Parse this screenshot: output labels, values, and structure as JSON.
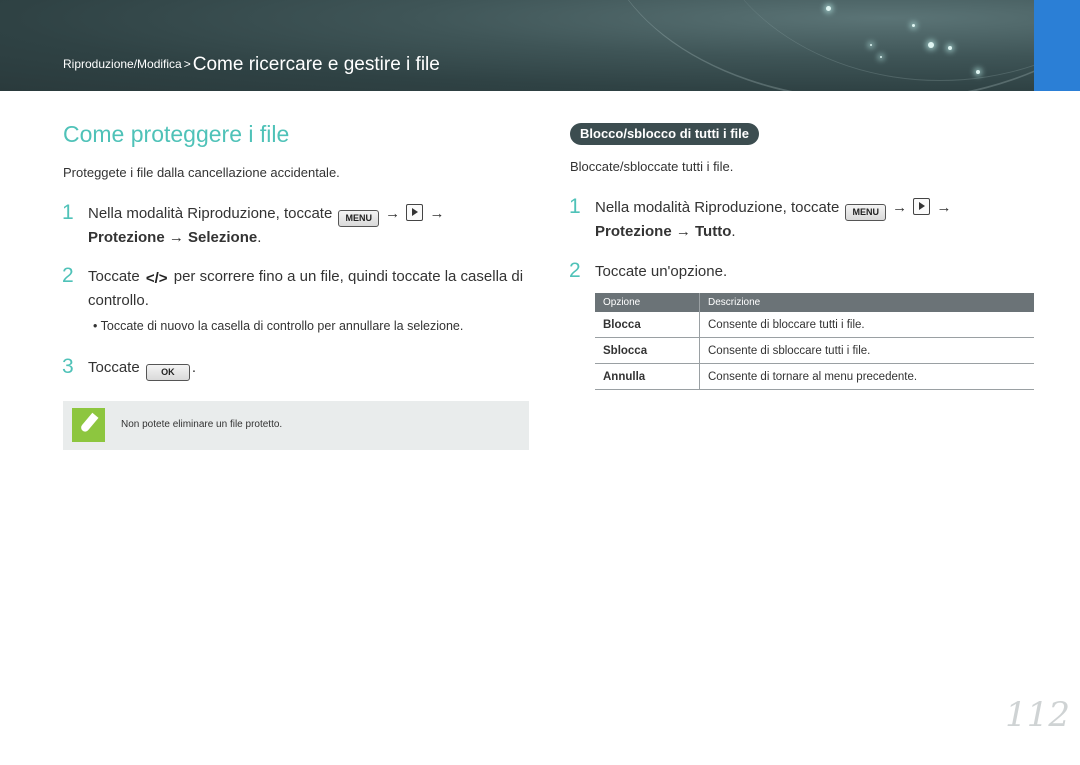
{
  "header": {
    "breadcrumb_section": "Riproduzione/Modifica",
    "breadcrumb_separator": ">",
    "breadcrumb_title": "Come ricercare e gestire i file"
  },
  "left": {
    "title": "Come proteggere i file",
    "intro": "Proteggete i file dalla cancellazione accidentale.",
    "step1": {
      "num": "1",
      "text_a": "Nella modalità Riproduzione, toccate",
      "key_menu": "MENU",
      "arrow": "→",
      "bold": "Protezione → Selezione",
      "period": "."
    },
    "step2": {
      "num": "2",
      "text_a": "Toccate",
      "nav_glyph": "</>",
      "text_b": "per scorrere fino a un file, quindi toccate la casella di controllo."
    },
    "bullet": "Toccate di nuovo la casella di controllo per annullare la selezione.",
    "bullet_mark": "•",
    "step3": {
      "num": "3",
      "text_a": "Toccate",
      "key_ok": "OK",
      "period": "."
    },
    "note": "Non potete eliminare un file protetto."
  },
  "right": {
    "pill": "Blocco/sblocco di tutti i file",
    "intro": "Bloccate/sbloccate tutti i file.",
    "step1": {
      "num": "1",
      "text_a": "Nella modalità Riproduzione, toccate",
      "key_menu": "MENU",
      "arrow": "→",
      "bold": "Protezione → Tutto",
      "period": "."
    },
    "step2": {
      "num": "2",
      "text": "Toccate un'opzione."
    },
    "table": {
      "headers": [
        "Opzione",
        "Descrizione"
      ],
      "rows": [
        {
          "option": "Blocca",
          "description": "Consente di bloccare tutti i file."
        },
        {
          "option": "Sblocca",
          "description": "Consente di sbloccare tutti i file."
        },
        {
          "option": "Annulla",
          "description": "Consente di tornare al menu precedente."
        }
      ]
    }
  },
  "page_number": "112",
  "icons": {
    "menu_key": "menu-key-icon",
    "playback": "playback-icon",
    "nav": "left-right-nav-icon",
    "ok_key": "ok-key-icon",
    "note": "note-pen-icon"
  },
  "colors": {
    "accent": "#4fc2b8",
    "banner": "#2f4244",
    "blue_tab": "#2b7fd6",
    "note_icon": "#8dc63f",
    "table_header": "#6b7377"
  }
}
